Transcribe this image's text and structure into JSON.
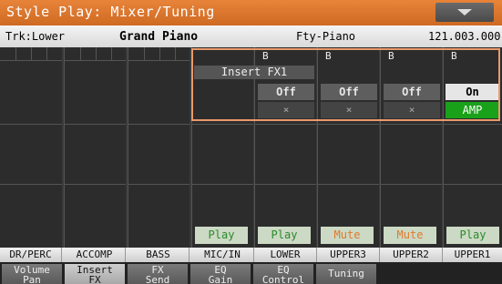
{
  "title": "Style Play: Mixer/Tuning",
  "info": {
    "track": "Trk:Lower",
    "sound": "Grand Piano",
    "category": "Fty-Piano",
    "bank": "121.003.000"
  },
  "insert_fx_label": "Insert FX1",
  "b_label": "B",
  "fx": {
    "off": "Off",
    "on": "On",
    "x": "×",
    "amp": "AMP"
  },
  "play": "Play",
  "mute": "Mute",
  "channels": [
    "DR/PERC",
    "ACCOMP",
    "BASS",
    "MIC/IN",
    "LOWER",
    "UPPER3",
    "UPPER2",
    "UPPER1"
  ],
  "tabs": [
    {
      "l1": "Volume",
      "l2": "Pan"
    },
    {
      "l1": "Insert",
      "l2": "FX"
    },
    {
      "l1": "FX",
      "l2": "Send"
    },
    {
      "l1": "EQ",
      "l2": "Gain"
    },
    {
      "l1": "EQ",
      "l2": "Control"
    },
    {
      "l1": "Tuning",
      "l2": ""
    }
  ],
  "colors": {
    "title_bar": "#d97026",
    "selection": "#e8996a",
    "amp_green": "#1aa11a",
    "play_text": "#2a8a2a",
    "mute_text": "#e07a2a"
  }
}
